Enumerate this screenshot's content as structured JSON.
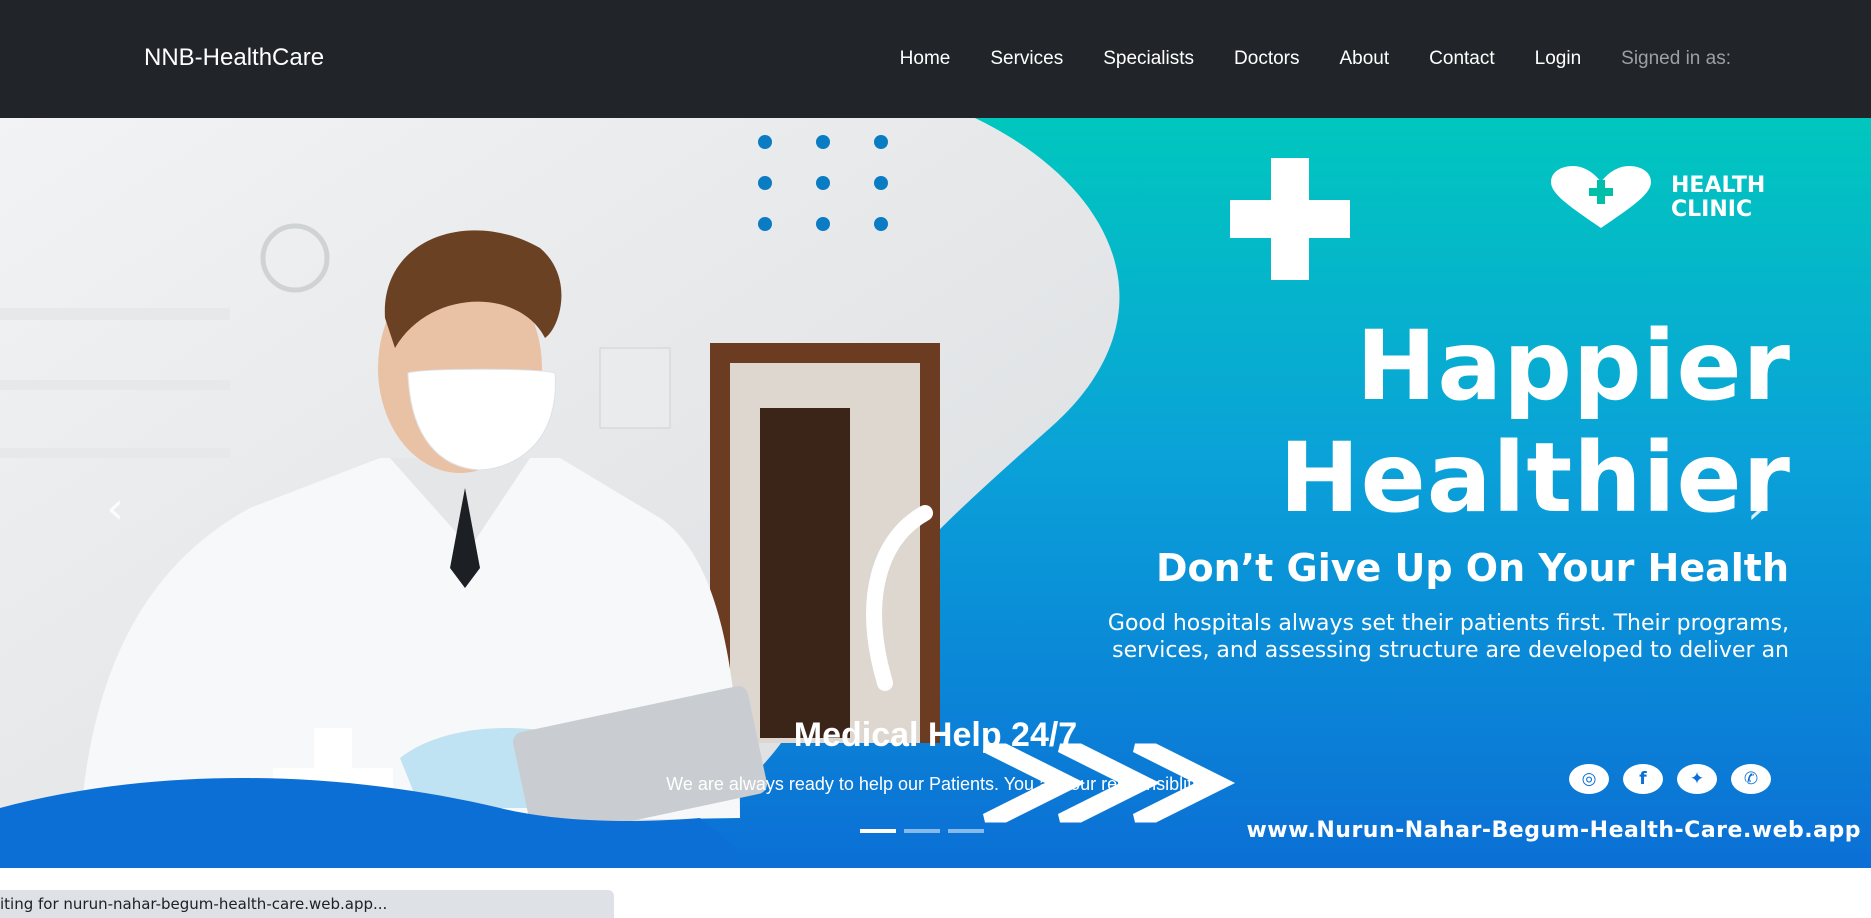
{
  "navbar": {
    "brand": "NNB-HealthCare",
    "links": [
      "Home",
      "Services",
      "Specialists",
      "Doctors",
      "About",
      "Contact",
      "Login"
    ],
    "signed_in": "Signed in as:"
  },
  "hero": {
    "clinic_name": "HEALTH CLINIC",
    "headline_1": "Happier",
    "headline_2": "Healthier",
    "subhead": "Don’t Give Up On Your Health",
    "blurb": "Good hospitals always set their patients first. Their programs, services, and assessing structure are developed to deliver an",
    "website": "www.Nurun-Nahar-Begum-Health-Care.web.app",
    "caption_title": "Medical Help 24/7",
    "caption_text": "We are always ready to help our Patients. You are our responsiblity.",
    "social_icons": [
      "instagram-icon",
      "facebook-icon",
      "twitter-icon",
      "whatsapp-icon"
    ],
    "indicators": 3,
    "active_indicator": 0,
    "prev_glyph": "‹",
    "next_glyph": "›"
  },
  "status_bar": {
    "text": "iting for nurun-nahar-begum-health-care.web.app..."
  },
  "colors": {
    "navbar_bg": "#212529",
    "teal": "#00c4c0",
    "blue": "#0b6fd6",
    "dots": "#0a7cc4"
  }
}
